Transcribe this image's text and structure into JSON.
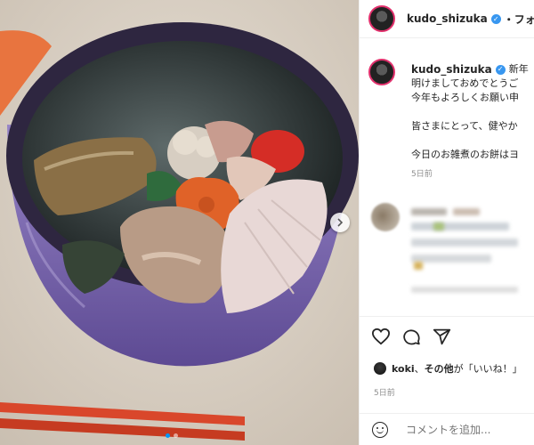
{
  "post": {
    "username": "kudo_shizuka",
    "follow_label": "・フォロ",
    "media": {
      "slide_count": 2,
      "active_slide": 1
    }
  },
  "caption": {
    "username": "kudo_shizuka",
    "tag": "新年",
    "lines": [
      "明けましておめでとうご",
      "今年もよろしくお願い申",
      "",
      "皆さまにとって、健やか",
      "",
      "今日のお雑煮のお餅はヨ"
    ],
    "time": "5日前"
  },
  "likes": {
    "user": "koki",
    "text_mid": "、",
    "others": "その他",
    "text_end": "が「いいね！」"
  },
  "time": "5日前",
  "comment": {
    "placeholder": "コメントを追加..."
  },
  "colors": {
    "verified": "#3897f0",
    "story_ring": "#e1306c",
    "bowl": "#7864a8",
    "chopsticks": "#d9472b",
    "muted": "#8e8e8e"
  }
}
